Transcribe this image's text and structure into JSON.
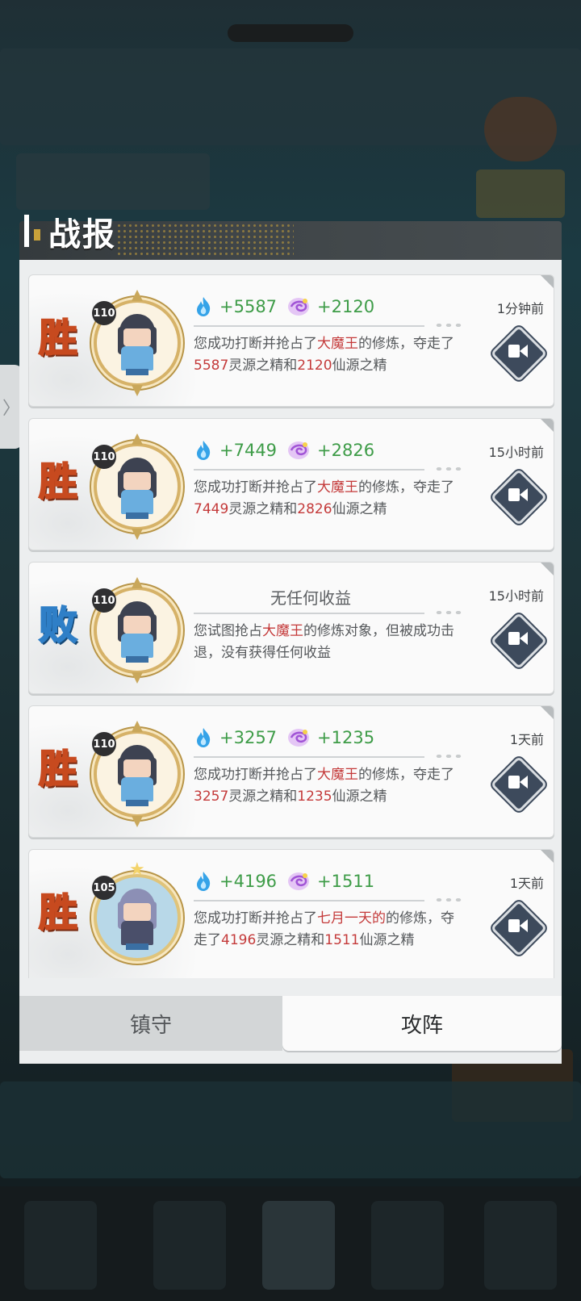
{
  "header": {
    "title": "战报"
  },
  "side_tab": {
    "glyph": "〉"
  },
  "reports": [
    {
      "result": "胜",
      "result_type": "win",
      "level": "110",
      "avatar": "swordsman-avatar",
      "gains": {
        "spirit_essence": "+5587",
        "immortal_essence": "+2120"
      },
      "desc": {
        "p1": "您成功打断并抢占了",
        "name": "大魔王",
        "p2": "的修炼，夺走了",
        "n1": "5587",
        "p3": "灵源之精和",
        "n2": "2120",
        "p4": "仙源之精"
      },
      "time": "1分钟前"
    },
    {
      "result": "胜",
      "result_type": "win",
      "level": "110",
      "avatar": "swordsman-avatar",
      "gains": {
        "spirit_essence": "+7449",
        "immortal_essence": "+2826"
      },
      "desc": {
        "p1": "您成功打断并抢占了",
        "name": "大魔王",
        "p2": "的修炼，夺走了",
        "n1": "7449",
        "p3": "灵源之精和",
        "n2": "2826",
        "p4": "仙源之精"
      },
      "time": "15小时前"
    },
    {
      "result": "败",
      "result_type": "lose",
      "level": "110",
      "avatar": "swordsman-avatar",
      "no_gain": "无任何收益",
      "desc": {
        "p1": "您试图抢占",
        "name": "大魔王",
        "p2": "的修炼对象，但被成功击退，没有获得任何收益"
      },
      "time": "15小时前"
    },
    {
      "result": "胜",
      "result_type": "win",
      "level": "110",
      "avatar": "swordsman-avatar",
      "gains": {
        "spirit_essence": "+3257",
        "immortal_essence": "+1235"
      },
      "desc": {
        "p1": "您成功打断并抢占了",
        "name": "大魔王",
        "p2": "的修炼，夺走了",
        "n1": "3257",
        "p3": "灵源之精和",
        "n2": "1235",
        "p4": "仙源之精"
      },
      "time": "1天前"
    },
    {
      "result": "胜",
      "result_type": "win",
      "level": "105",
      "avatar": "elf-avatar",
      "gains": {
        "spirit_essence": "+4196",
        "immortal_essence": "+1511"
      },
      "desc": {
        "p1": "您成功打断并抢占了",
        "name": "七月一天的",
        "p2": "的修炼，夺走了",
        "n1": "4196",
        "p3": "灵源之精和",
        "n2": "1511",
        "p4": "仙源之精"
      },
      "time": "1天前"
    }
  ],
  "tabs": {
    "defend": "镇守",
    "attack": "攻阵",
    "active": "attack"
  },
  "colors": {
    "win_text": "#c74a1f",
    "lose_text": "#2f7fc7",
    "gain_green": "#3e9c48",
    "highlight_red": "#c43a3a"
  },
  "icons": {
    "spirit_essence": "blue-flame-icon",
    "immortal_essence": "purple-swirl-icon",
    "replay": "video-camera-icon"
  }
}
